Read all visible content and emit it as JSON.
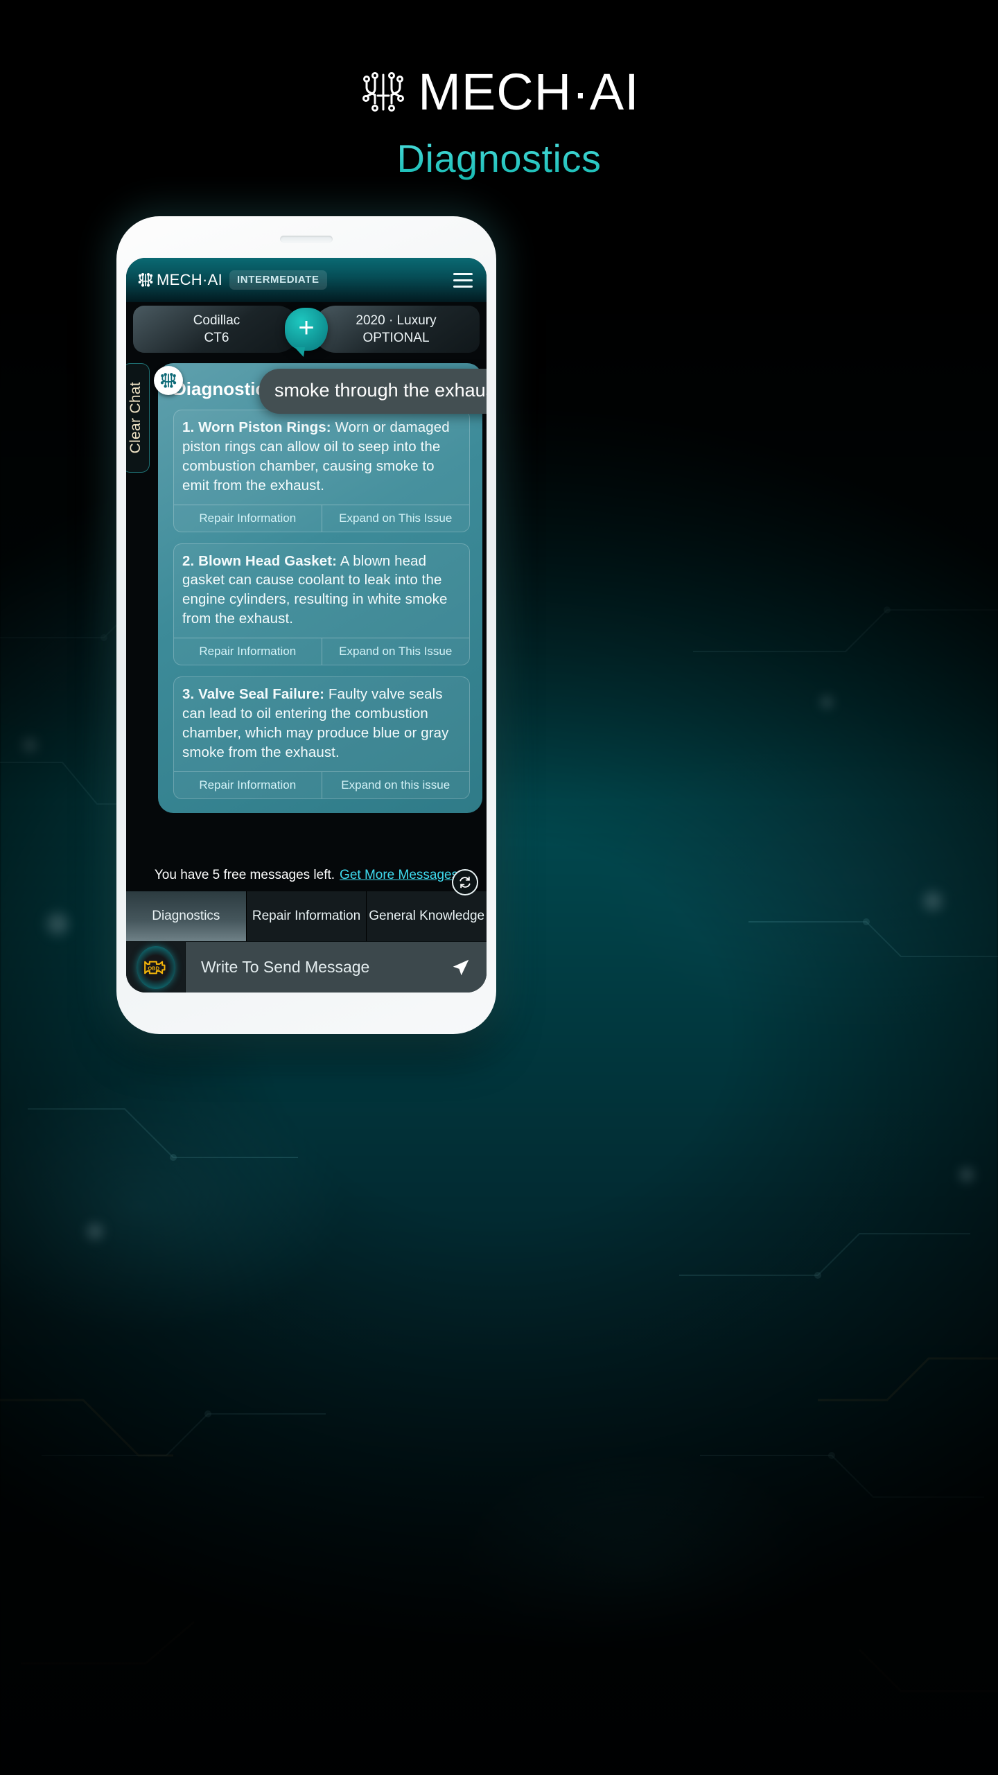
{
  "brand": {
    "wordmark": "MECH·AI",
    "logo_icon": "circuit-logo-icon"
  },
  "page_title": "Diagnostics",
  "app_header": {
    "logo_text": "MECH·AI",
    "badge": "INTERMEDIATE",
    "menu_icon": "hamburger-menu-icon"
  },
  "vehicle": {
    "left_line1": "Codillac",
    "left_line2": "CT6",
    "add_label": "+",
    "right_line1": "2020 · Luxury",
    "right_line2": "OPTIONAL"
  },
  "chat": {
    "clear_chat": "Clear Chat",
    "avatar_icon": "circuit-logo-icon",
    "user_message": "smoke through the exhaust",
    "card_title": "Diagnostics:",
    "issues": [
      {
        "number": "1.",
        "heading": "Worn Piston Rings:",
        "body": " Worn or damaged piston rings can allow oil to seep into the combustion chamber, causing smoke to emit from the exhaust.",
        "action_left": "Repair Information",
        "action_right": "Expand on This Issue"
      },
      {
        "number": "2.",
        "heading": "Blown Head Gasket:",
        "body": " A blown head gasket can cause coolant to leak into the engine cylinders, resulting in white smoke from the exhaust.",
        "action_left": "Repair Information",
        "action_right": "Expand on This Issue"
      },
      {
        "number": "3.",
        "heading": "Valve Seal Failure:",
        "body": " Faulty valve seals can lead to oil entering the combustion chamber, which may produce blue or gray smoke from the exhaust.",
        "action_left": "Repair Information",
        "action_right": "Expand on this issue"
      }
    ]
  },
  "free_messages": {
    "text": "You have 5 free messages left.",
    "link": "Get More Messages",
    "refresh_icon": "refresh-icon"
  },
  "tabs": [
    {
      "label": "Diagnostics",
      "active": true
    },
    {
      "label": "Repair Information",
      "active": false
    },
    {
      "label": "General Knowledge",
      "active": false
    }
  ],
  "composer": {
    "obd_icon": "obd-check-engine-icon",
    "obd_label": "OBD",
    "placeholder": "Write To Send Message",
    "send_icon": "send-arrow-icon"
  },
  "colors": {
    "accent_teal": "#15b8b0",
    "link_cyan": "#3fdcf0",
    "card_teal": "#3d8b99",
    "header_teal": "#064e57",
    "obd_yellow": "#f5b60a"
  }
}
